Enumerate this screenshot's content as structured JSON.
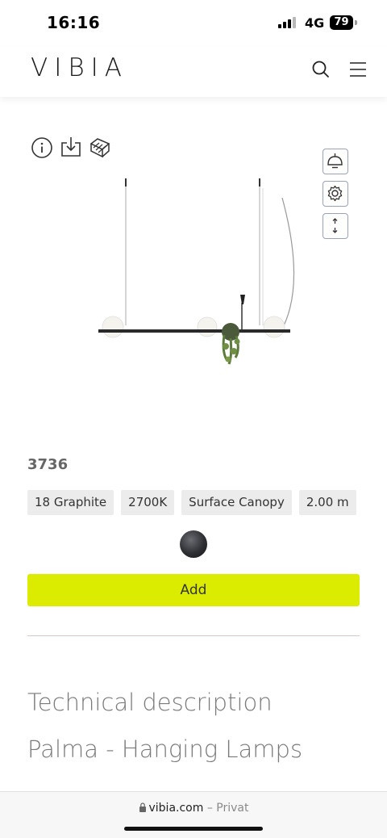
{
  "status": {
    "time": "16:16",
    "network": "4G",
    "battery": "79"
  },
  "header": {
    "logo": "VIBIA",
    "icons": [
      "search-icon",
      "menu-icon"
    ]
  },
  "product": {
    "tools": [
      "info-icon",
      "download-icon",
      "ar-cube-icon"
    ],
    "side_tools": [
      "lamp-icon",
      "settings-icon",
      "adjust-height-icon"
    ],
    "code": "3736",
    "options": [
      "18 Graphite",
      "2700K",
      "Surface Canopy",
      "2.00 m"
    ],
    "swatch_color": "#2e2f33",
    "add_label": "Add",
    "accent_color": "#dcec00"
  },
  "sections": {
    "technical": "Technical description",
    "family": "Palma - Hanging Lamps"
  },
  "browser": {
    "domain": "vibia.com",
    "mode": "– Privat"
  }
}
